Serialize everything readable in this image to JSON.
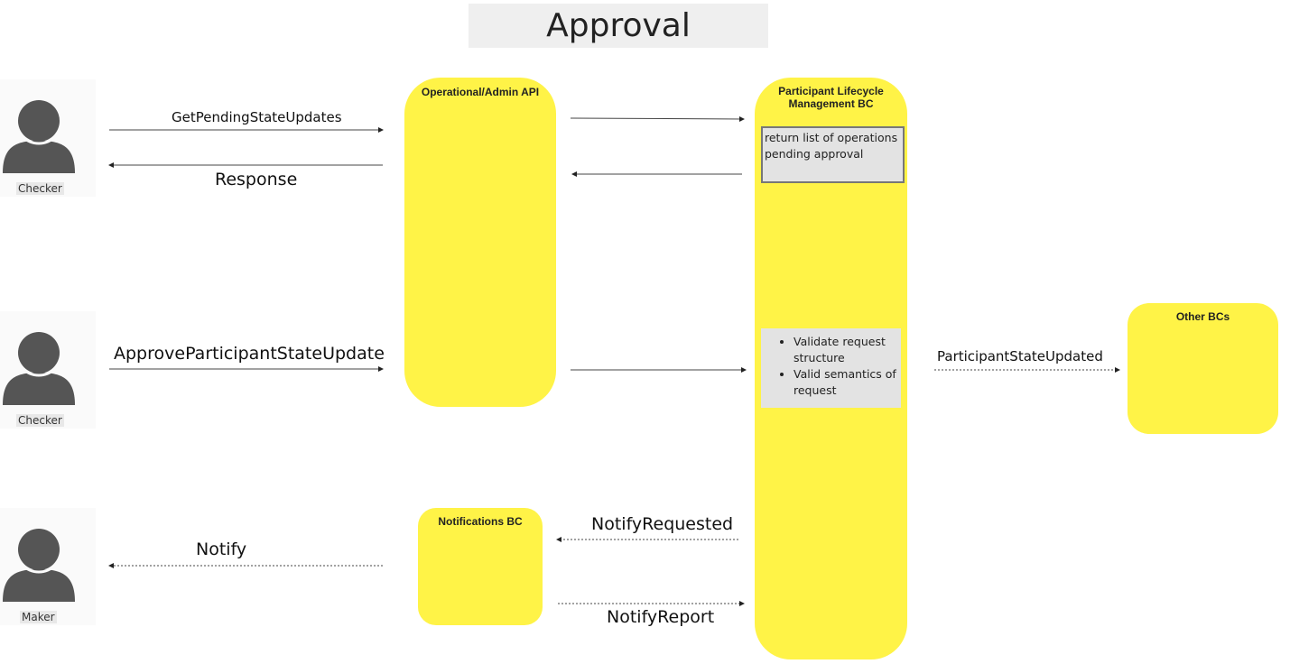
{
  "title": "Approval",
  "actors": [
    {
      "label": "Checker"
    },
    {
      "label": "Checker"
    },
    {
      "label": "Maker"
    }
  ],
  "components": {
    "ops_api": {
      "title": "Operational/Admin API"
    },
    "plm_bc": {
      "title_line1": "Participant Lifecycle",
      "title_line2": "Management BC"
    },
    "other_bcs": {
      "title": "Other BCs"
    },
    "notifications_bc": {
      "title": "Notifications BC"
    }
  },
  "notes": {
    "pending": "return list of operations pending approval",
    "validate_items": [
      "Validate request structure",
      "Valid semantics of request"
    ]
  },
  "messages": {
    "get_pending": "GetPendingStateUpdates",
    "response": "Response",
    "approve": "ApproveParticipantStateUpdate",
    "state_updated": "ParticipantStateUpdated",
    "notify_requested": "NotifyRequested",
    "notify": "Notify",
    "notify_report": "NotifyReport"
  }
}
